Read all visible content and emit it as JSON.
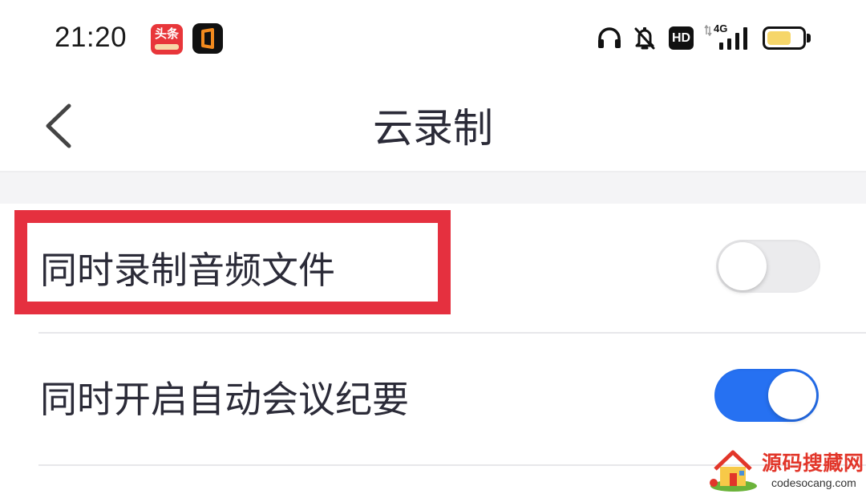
{
  "status_bar": {
    "time": "21:20",
    "apps": [
      {
        "icon": "toutiao-app-icon",
        "label": "头条"
      },
      {
        "icon": "office-app-icon"
      }
    ],
    "indicators": {
      "headphones_icon": "headphones-icon",
      "mute_icon": "bell-off-icon",
      "hd_label": "HD",
      "network_label": "4G",
      "signal_icon": "signal-bars-icon",
      "battery_icon": "battery-icon",
      "battery_level": 0.7
    }
  },
  "nav": {
    "back_icon": "chevron-left-icon",
    "title": "云录制"
  },
  "settings": [
    {
      "label": "同时录制音频文件",
      "enabled": false,
      "highlighted": true
    },
    {
      "label": "同时开启自动会议纪要",
      "enabled": true,
      "highlighted": false
    }
  ],
  "watermark": {
    "logo_icon": "house-logo-icon",
    "name": "源码搜藏网",
    "domain": "codesocang.com"
  },
  "colors": {
    "text": "#2b2b38",
    "accent": "#2671f2",
    "highlight": "#e5303f",
    "toggle_off": "#ebebed",
    "section_bg": "#f4f4f6",
    "divider": "#e7e7ea",
    "battery": "#f6d66a",
    "watermark": "#e2362a"
  }
}
